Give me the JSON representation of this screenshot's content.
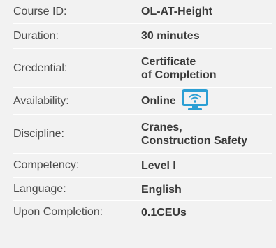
{
  "rows": [
    {
      "label": "Course ID:",
      "value_lines": [
        "OL-AT-Height"
      ]
    },
    {
      "label": "Duration:",
      "value_lines": [
        "30 minutes"
      ]
    },
    {
      "label": "Credential:",
      "value_lines": [
        "Certificate",
        "of Completion"
      ]
    },
    {
      "label": "Availability:",
      "value_lines": [
        "Online"
      ],
      "icon": "wifi-monitor-icon"
    },
    {
      "label": "Discipline:",
      "value_lines": [
        "Cranes,",
        "Construction Safety"
      ]
    },
    {
      "label": "Competency:",
      "value_lines": [
        "Level I"
      ]
    },
    {
      "label": "Language:",
      "value_lines": [
        "English"
      ]
    },
    {
      "label": "Upon Completion:",
      "value_lines": [
        "0.1CEUs"
      ]
    }
  ],
  "colors": {
    "background": "#f2f2f2",
    "text": "#3a3a3a",
    "icon": "#2b9fd4"
  }
}
